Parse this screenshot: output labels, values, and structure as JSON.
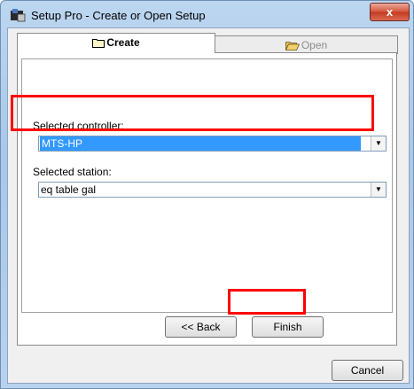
{
  "window": {
    "title": "Setup Pro - Create or Open Setup",
    "close_label": "x"
  },
  "tabs": [
    {
      "label": "Create",
      "mnemonic": "r",
      "active": true
    },
    {
      "label": "Open",
      "mnemonic": "O",
      "active": false
    }
  ],
  "fields": {
    "controller": {
      "label": "Selected controller:",
      "value": "MTS-HP"
    },
    "station": {
      "label": "Selected station:",
      "value": "eq table gal"
    }
  },
  "buttons": {
    "back": "<< Back",
    "finish": "Finish",
    "cancel": "Cancel"
  },
  "colors": {
    "selection": "#3399ff",
    "annotation": "#ff0000",
    "close": "#c43a22"
  },
  "icons": [
    "app-icon",
    "folder-icon",
    "open-folder-icon",
    "dropdown-arrow-icon",
    "close-icon"
  ]
}
